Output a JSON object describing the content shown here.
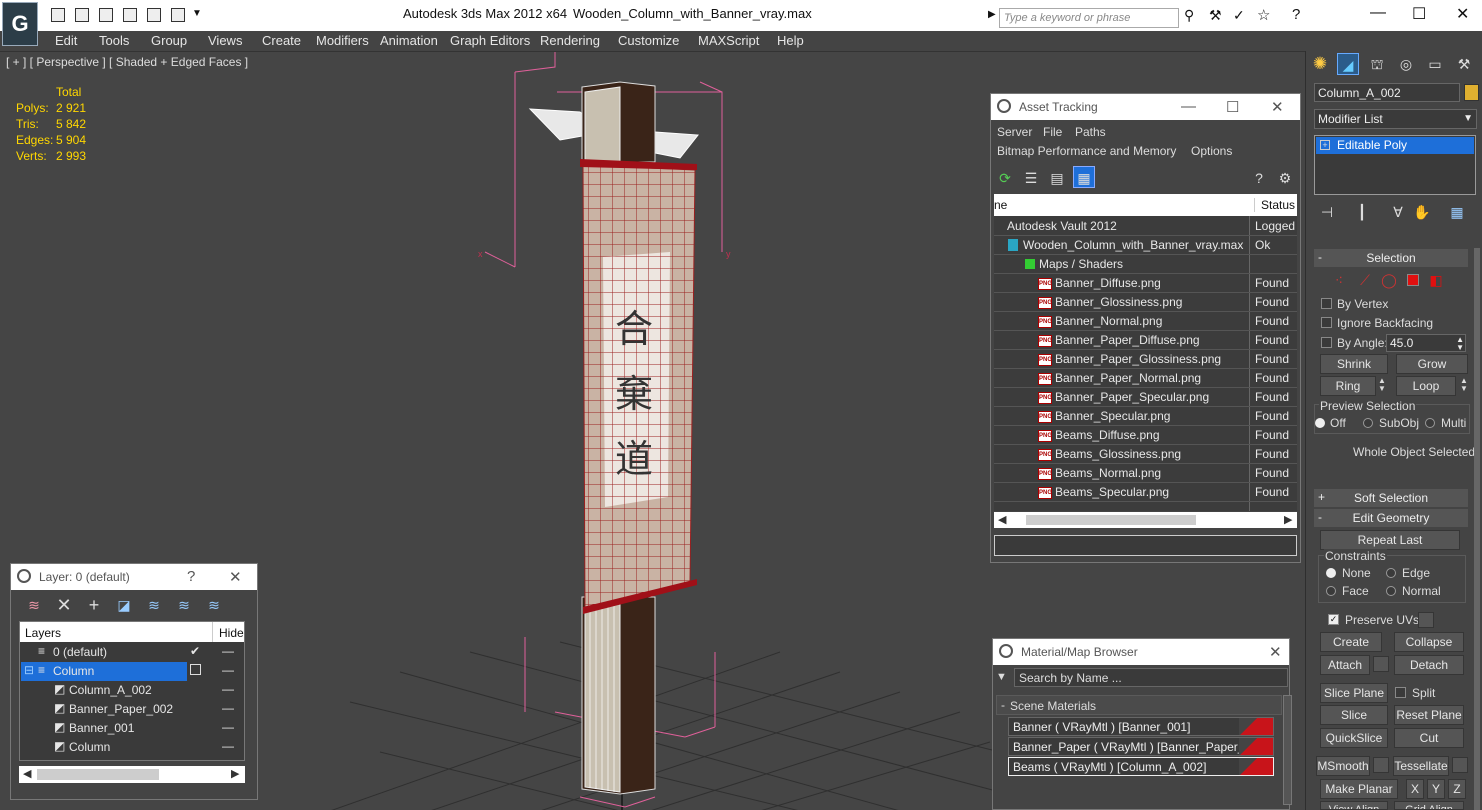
{
  "app": {
    "title": "Autodesk 3ds Max  2012 x64",
    "file": "Wooden_Column_with_Banner_vray.max",
    "search_placeholder": "Type a keyword or phrase"
  },
  "menu": [
    "Edit",
    "Tools",
    "Group",
    "Views",
    "Create",
    "Modifiers",
    "Animation",
    "Graph Editors",
    "Rendering",
    "Customize",
    "MAXScript",
    "Help"
  ],
  "viewport": {
    "label": "[ + ] [ Perspective ] [ Shaded + Edged Faces ]",
    "stats_header": "Total",
    "stats": [
      {
        "label": "Polys:",
        "value": "2 921"
      },
      {
        "label": "Tris:",
        "value": "5 842"
      },
      {
        "label": "Edges:",
        "value": "5 904"
      },
      {
        "label": "Verts:",
        "value": "2 993"
      }
    ]
  },
  "asset_tracking": {
    "title": "Asset Tracking",
    "menu_row1": [
      "Server",
      "File",
      "Paths"
    ],
    "menu_row2": [
      "Bitmap Performance and Memory",
      "Options"
    ],
    "col_name": "ne",
    "col_status": "Status",
    "vault": {
      "name": "Autodesk Vault 2012",
      "status": "Logged"
    },
    "file": {
      "name": "Wooden_Column_with_Banner_vray.max",
      "status": "Ok"
    },
    "group": "Maps / Shaders",
    "files": [
      {
        "name": "Banner_Diffuse.png",
        "status": "Found"
      },
      {
        "name": "Banner_Glossiness.png",
        "status": "Found"
      },
      {
        "name": "Banner_Normal.png",
        "status": "Found"
      },
      {
        "name": "Banner_Paper_Diffuse.png",
        "status": "Found"
      },
      {
        "name": "Banner_Paper_Glossiness.png",
        "status": "Found"
      },
      {
        "name": "Banner_Paper_Normal.png",
        "status": "Found"
      },
      {
        "name": "Banner_Paper_Specular.png",
        "status": "Found"
      },
      {
        "name": "Banner_Specular.png",
        "status": "Found"
      },
      {
        "name": "Beams_Diffuse.png",
        "status": "Found"
      },
      {
        "name": "Beams_Glossiness.png",
        "status": "Found"
      },
      {
        "name": "Beams_Normal.png",
        "status": "Found"
      },
      {
        "name": "Beams_Specular.png",
        "status": "Found"
      }
    ]
  },
  "layer_dialog": {
    "title": "Layer: 0 (default)",
    "help": "?",
    "col_layers": "Layers",
    "col_hide": "Hide",
    "rows": [
      {
        "name": "0 (default)"
      },
      {
        "name": "Column"
      },
      {
        "name": "Column_A_002"
      },
      {
        "name": "Banner_Paper_002"
      },
      {
        "name": "Banner_001"
      },
      {
        "name": "Column"
      }
    ]
  },
  "material_browser": {
    "title": "Material/Map Browser",
    "search_placeholder": "Search by Name ...",
    "section": "Scene Materials",
    "materials": [
      "Banner  ( VRayMtl ) [Banner_001]",
      "Banner_Paper  ( VRayMtl ) [Banner_Paper_002]",
      "Beams  ( VRayMtl ) [Column_A_002]"
    ]
  },
  "command_panel": {
    "object_name": "Column_A_002",
    "object_color": "#e0b030",
    "modifier_list": "Modifier List",
    "stack_item": "Editable Poly",
    "selection": {
      "title": "Selection",
      "by_vertex": "By Vertex",
      "ignore_backfacing": "Ignore Backfacing",
      "by_angle": "By Angle:",
      "angle_value": "45.0",
      "shrink": "Shrink",
      "grow": "Grow",
      "ring": "Ring",
      "loop": "Loop",
      "preview_title": "Preview Selection",
      "preview_off": "Off",
      "preview_subobj": "SubObj",
      "preview_multi": "Multi",
      "status": "Whole Object Selected"
    },
    "soft_selection": "Soft Selection",
    "edit_geometry": {
      "title": "Edit Geometry",
      "repeat_last": "Repeat Last",
      "constraints": "Constraints",
      "none": "None",
      "edge": "Edge",
      "face": "Face",
      "normal": "Normal",
      "preserve_uvs": "Preserve UVs",
      "create": "Create",
      "collapse": "Collapse",
      "attach": "Attach",
      "detach": "Detach",
      "slice_plane": "Slice Plane",
      "split": "Split",
      "slice": "Slice",
      "reset_plane": "Reset Plane",
      "quickslice": "QuickSlice",
      "cut": "Cut",
      "msmooth": "MSmooth",
      "tessellate": "Tessellate",
      "make_planar": "Make Planar",
      "x": "X",
      "y": "Y",
      "z": "Z",
      "view_align": "View Align",
      "grid_align": "Grid Align"
    }
  },
  "colors": {
    "selection_blue": "#1e6fd9",
    "stat_yellow": "#ffd700",
    "banner_red": "#b01018",
    "wireframe_pink": "#e0609a"
  }
}
